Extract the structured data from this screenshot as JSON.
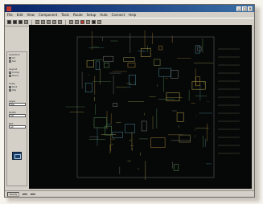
{
  "window": {
    "title": "",
    "accent_color": "#0a246a",
    "canvas_color": "#060807"
  },
  "titlebar_buttons": [
    {
      "name": "minimize-button",
      "glyph": "_"
    },
    {
      "name": "maximize-button",
      "glyph": "□"
    },
    {
      "name": "close-button",
      "glyph": "×"
    }
  ],
  "menubar": {
    "items": [
      "File",
      "Edit",
      "View",
      "Component",
      "Tools",
      "Route",
      "Setup",
      "Auto",
      "Connect",
      "Help"
    ]
  },
  "toolbar": {
    "icons": [
      "new-icon",
      "open-icon",
      "save-icon",
      "print-icon",
      "cut-icon",
      "copy-icon",
      "paste-icon",
      "undo-icon",
      "redo-icon",
      "zoom-in-icon",
      "zoom-out-icon",
      "layer-icon",
      "route-icon",
      "drc-icon",
      "help-icon"
    ]
  },
  "sidebar": {
    "groups": [
      {
        "label": "Selection",
        "options": [
          {
            "label": "All",
            "checked": false
          },
          {
            "label": "Sel",
            "checked": true
          }
        ]
      },
      {
        "label": "Layout",
        "options": [
          {
            "label": "Comp",
            "checked": true
          },
          {
            "label": "Trace",
            "checked": false
          }
        ]
      },
      {
        "label": "Snap",
        "options": [
          {
            "label": "Grid",
            "checked": true
          },
          {
            "label": "Obj",
            "checked": false
          }
        ]
      }
    ],
    "selects": [
      {
        "label": "Layer",
        "value": "Top"
      },
      {
        "label": "Width",
        "value": "10"
      },
      {
        "label": "Net",
        "value": "all"
      }
    ],
    "icon_name": "board-icon"
  },
  "statusbar": {
    "cells": [
      "Ready",
      "",
      ""
    ]
  }
}
